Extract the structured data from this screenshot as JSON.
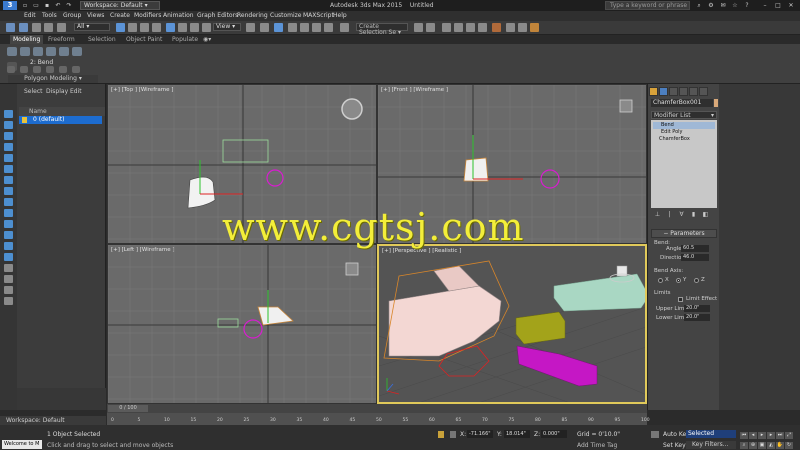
{
  "titlebar": {
    "workspace_label": "Workspace: Default",
    "app_title": "Autodesk 3ds Max 2015",
    "file_name": "Untitled",
    "search_placeholder": "Type a keyword or phrase"
  },
  "menus": [
    "Edit",
    "Tools",
    "Group",
    "Views",
    "Create",
    "Modifiers",
    "Animation",
    "Graph Editors",
    "Rendering",
    "Customize",
    "MAXScript",
    "Help"
  ],
  "toolbar": {
    "filter_value": "All",
    "reference_coord": "View",
    "selection_set_placeholder": "Create Selection Se"
  },
  "ribbon": {
    "tabs": [
      "Modeling",
      "Freeform",
      "Selection",
      "Object Paint",
      "Populate"
    ],
    "active_tab": "Modeling",
    "modifier_label": "2: Bend",
    "panel_label": "Polygon Modeling"
  },
  "scene_explorer": {
    "menus": [
      "Select",
      "Display",
      "Edit"
    ],
    "column_header": "Name",
    "rows": [
      "0 (default)"
    ]
  },
  "viewports": {
    "top": "[+] [Top ] [Wireframe ]",
    "front": "[+] [Front ] [Wireframe ]",
    "left": "[+] [Left ] [Wireframe ]",
    "perspective": "[+] [Perspective ] [Realistic ]"
  },
  "command_panel": {
    "object_name": "ChamferBox001",
    "modifier_list": "Modifier List",
    "stack": [
      "Bend",
      "Edit Poly",
      "ChamferBox"
    ],
    "parameters_title": "Parameters",
    "bend_label": "Bend:",
    "angle_label": "Angle:",
    "angle_value": "60.5",
    "direction_label": "Direction:",
    "direction_value": "46.0",
    "bend_axis_label": "Bend Axis:",
    "axes": [
      "X",
      "Y",
      "Z"
    ],
    "selected_axis": "Y",
    "limits_label": "Limits",
    "limit_effect_label": "Limit Effect",
    "upper_limit_label": "Upper Limit:",
    "upper_limit_value": "20.0\"",
    "lower_limit_label": "Lower Limit:",
    "lower_limit_value": "20.0\""
  },
  "timeline": {
    "slider_label": "0 / 100",
    "ticks": [
      "0",
      "5",
      "10",
      "15",
      "20",
      "25",
      "30",
      "35",
      "40",
      "45",
      "50",
      "55",
      "60",
      "65",
      "70",
      "75",
      "80",
      "85",
      "90",
      "95",
      "100"
    ]
  },
  "workspace_bottom": "Workspace: Default",
  "status": {
    "maxscript": "Welcome to M",
    "selection_info": "1 Object Selected",
    "prompt": "Click and drag to select and move objects",
    "x_label": "X:",
    "x_value": "-71.166\"",
    "y_label": "Y:",
    "y_value": "18.014\"",
    "z_label": "Z:",
    "z_value": "0.000\"",
    "grid_label": "Grid = 0'10.0\"",
    "add_time_tag": "Add Time Tag",
    "auto_key": "Auto Key",
    "set_key": "Set Key",
    "selected_value": "Selected",
    "key_filters": "Key Filters..."
  },
  "watermark": "www.cgtsj.com",
  "colors": {
    "selection_blue": "#1d6ccf",
    "active_viewport_border": "#e0c95a",
    "watermark": "#f3ee3a",
    "light_magenta": "#d81cd0"
  }
}
